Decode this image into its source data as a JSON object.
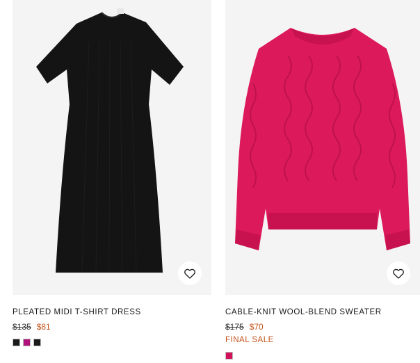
{
  "products": [
    {
      "name": "PLEATED MIDI T-SHIRT DRESS",
      "original_price": "$135",
      "sale_price": "$81",
      "badge": "",
      "swatch_colors": [
        "#1a1a1a",
        "#b0117a",
        "#1a1a1a"
      ],
      "garment_color": "#141414",
      "wishlist_icon": "heart-outline-icon"
    },
    {
      "name": "CABLE-KNIT WOOL-BLEND SWEATER",
      "original_price": "$175",
      "sale_price": "$70",
      "badge": "FINAL SALE",
      "swatch_colors": [
        "#d0135a"
      ],
      "garment_color": "#dc1a5b",
      "wishlist_icon": "heart-outline-icon"
    }
  ],
  "colors": {
    "sale_price": "#c4541c",
    "image_background": "#f4f4f4"
  }
}
